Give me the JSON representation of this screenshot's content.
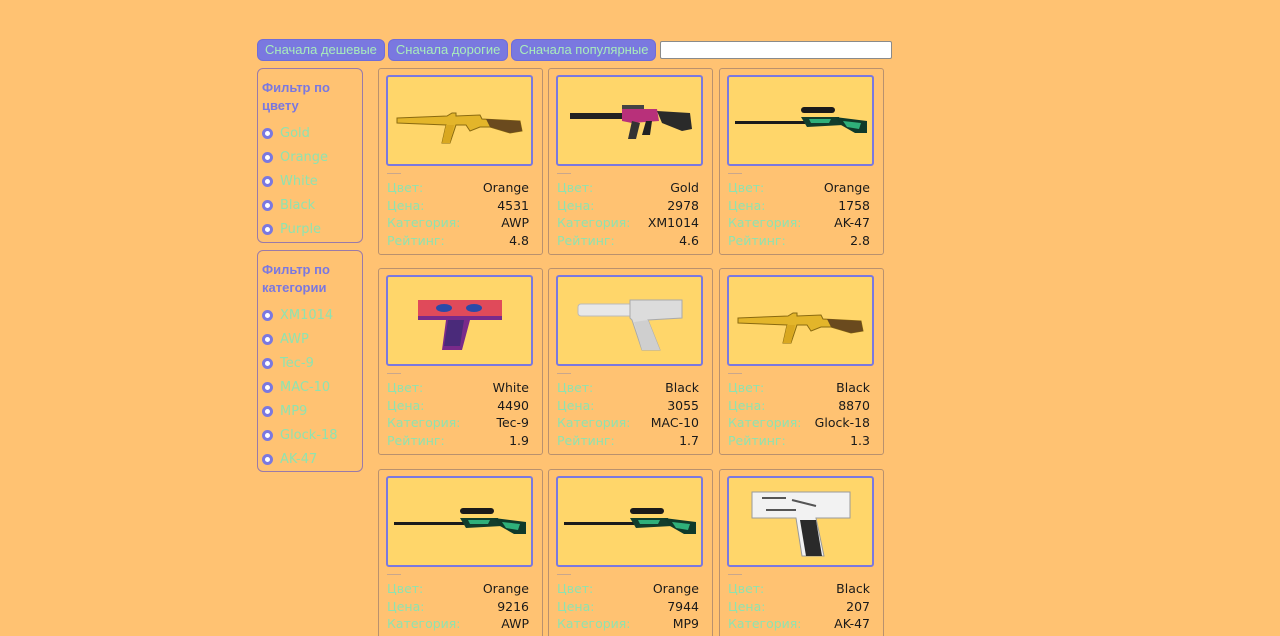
{
  "sort": {
    "cheap_label": "Сначала дешевые",
    "expensive_label": "Сначала дорогие",
    "popular_label": "Сначала популярные",
    "search_value": ""
  },
  "filters": {
    "color": {
      "title": "Фильтр по цвету",
      "options": [
        "Gold",
        "Orange",
        "White",
        "Black",
        "Purple"
      ]
    },
    "category": {
      "title": "Фильтр по категории",
      "options": [
        "XM1014",
        "AWP",
        "Tec-9",
        "MAC-10",
        "MP9",
        "Glock-18",
        "AK-47"
      ]
    }
  },
  "labels": {
    "color": "Цвет:",
    "price": "Цена:",
    "category": "Категория:",
    "rating": "Рейтинг:"
  },
  "products": [
    {
      "image": "ak47-gold-icon",
      "color": "Orange",
      "price": "4531",
      "category": "AWP",
      "rating": "4.8"
    },
    {
      "image": "xm1014-purple-icon",
      "color": "Gold",
      "price": "2978",
      "category": "XM1014",
      "rating": "4.6"
    },
    {
      "image": "awp-green-icon",
      "color": "Orange",
      "price": "1758",
      "category": "AK-47",
      "rating": "2.8"
    },
    {
      "image": "glock-purple-icon",
      "color": "White",
      "price": "4490",
      "category": "Tec-9",
      "rating": "1.9"
    },
    {
      "image": "usp-white-icon",
      "color": "Black",
      "price": "3055",
      "category": "MAC-10",
      "rating": "1.7"
    },
    {
      "image": "ak47-gold-icon",
      "color": "Black",
      "price": "8870",
      "category": "Glock-18",
      "rating": "1.3"
    },
    {
      "image": "awp-green-icon",
      "color": "Orange",
      "price": "9216",
      "category": "AWP",
      "rating": ""
    },
    {
      "image": "awp-green-icon",
      "color": "Orange",
      "price": "7944",
      "category": "MP9",
      "rating": ""
    },
    {
      "image": "deagle-white-icon",
      "color": "Black",
      "price": "207",
      "category": "AK-47",
      "rating": ""
    }
  ],
  "colors": {
    "background": "#ffc272",
    "accent": "#7a78e0",
    "label_text": "#8ee3b0",
    "image_bg": "#ffd66a"
  }
}
